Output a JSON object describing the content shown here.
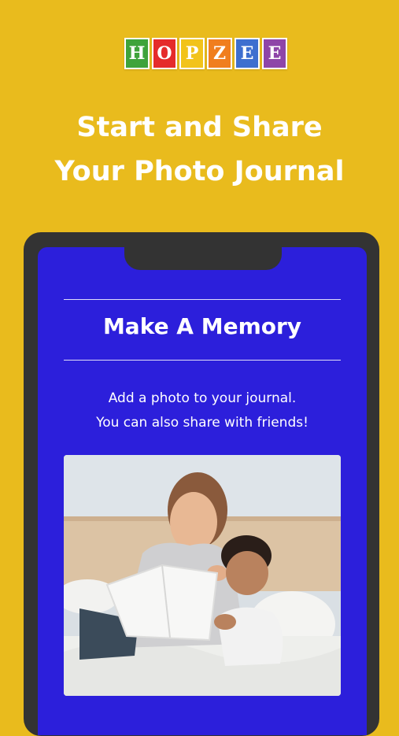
{
  "logo": {
    "letters": [
      "H",
      "O",
      "P",
      "Z",
      "E",
      "E"
    ],
    "colors": [
      "#3FA33B",
      "#E52B2B",
      "#F2C31A",
      "#F07E1E",
      "#3E6FCF",
      "#8E45A8"
    ]
  },
  "headline": {
    "line1": "Start and Share",
    "line2": "Your Photo Journal"
  },
  "screen": {
    "title": "Make A Memory",
    "desc_line1": "Add a photo to your journal.",
    "desc_line2": "You can also share with friends!"
  },
  "colors": {
    "background": "#E9BB1D",
    "phone_frame": "#333333",
    "screen": "#2C1FDB"
  }
}
